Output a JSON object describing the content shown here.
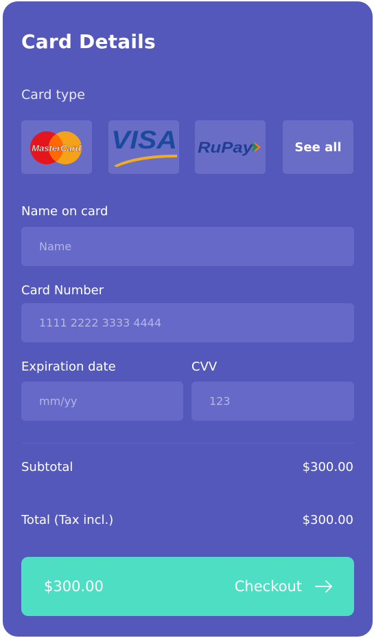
{
  "header": {
    "title": "Card Details"
  },
  "card_type": {
    "label": "Card type",
    "options": [
      {
        "name": "MasterCard",
        "icon": "mastercard-logo"
      },
      {
        "name": "VISA",
        "icon": "visa-logo"
      },
      {
        "name": "RuPay",
        "icon": "rupay-logo"
      },
      {
        "name": "See all",
        "icon": ""
      }
    ]
  },
  "name_on_card": {
    "label": "Name on card",
    "placeholder": "Name"
  },
  "card_number": {
    "label": "Card Number",
    "placeholder": "1111 2222 3333 4444"
  },
  "expiration": {
    "label": "Expiration date",
    "placeholder": "mm/yy"
  },
  "cvv": {
    "label": "CVV",
    "placeholder": "123"
  },
  "summary": {
    "subtotal_label": "Subtotal",
    "subtotal_value": "$300.00",
    "total_label": "Total (Tax incl.)",
    "total_value": "$300.00"
  },
  "checkout": {
    "amount": "$300.00",
    "label": "Checkout",
    "icon": "arrow-right-icon"
  },
  "colors": {
    "panel": "#5558bb",
    "input": "#6669c8",
    "tile": "#6a6dc6",
    "checkout": "#4ddec3"
  }
}
